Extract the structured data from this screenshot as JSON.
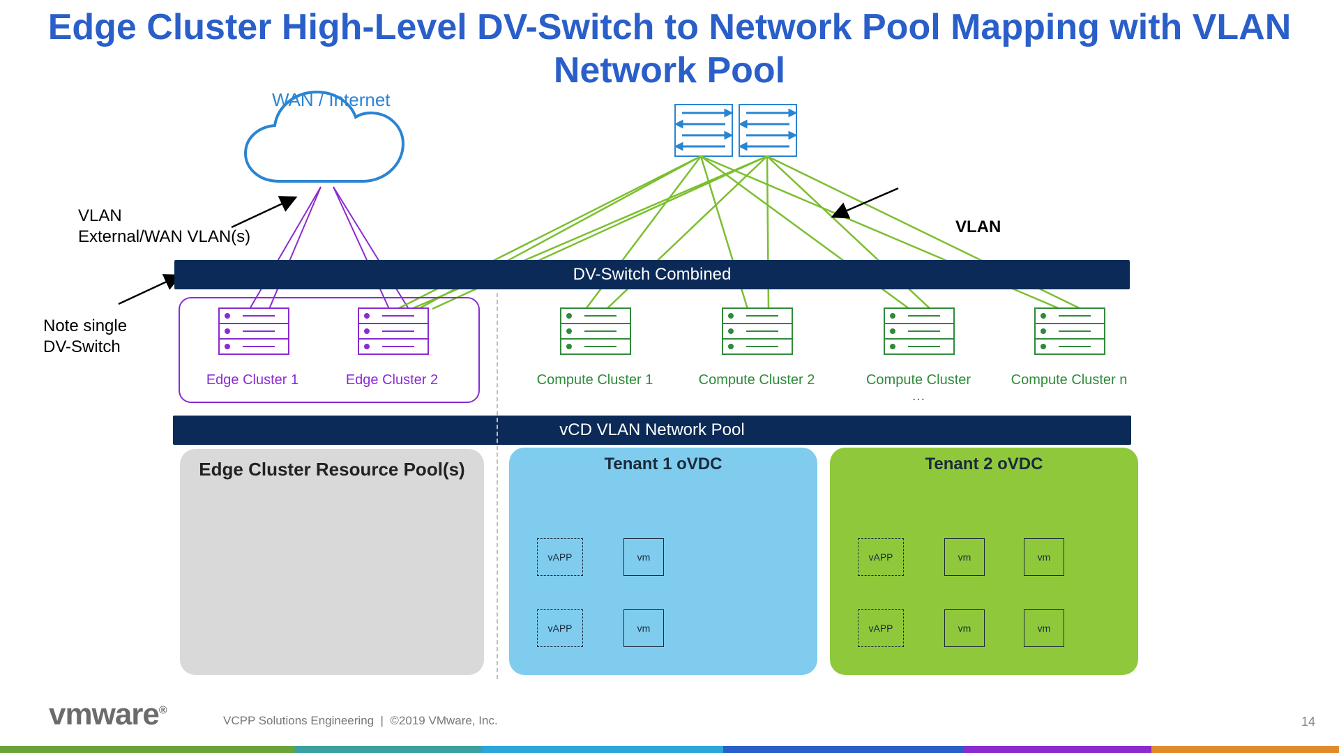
{
  "title": "Edge Cluster High-Level DV-Switch to Network Pool Mapping with VLAN Network Pool",
  "wan_label": "WAN / Internet",
  "annotations": {
    "ext_vlan_line1": "VLAN",
    "ext_vlan_line2": "External/WAN VLAN(s)",
    "note_single_line1": "Note single",
    "note_single_line2": "DV-Switch",
    "right_vlan": "VLAN"
  },
  "bars": {
    "dvswitch": "DV-Switch Combined",
    "pool": "vCD VLAN Network Pool"
  },
  "clusters": {
    "edge": [
      "Edge Cluster 1",
      "Edge Cluster 2"
    ],
    "compute": [
      "Compute Cluster 1",
      "Compute Cluster 2",
      "Compute Cluster …",
      "Compute Cluster n"
    ]
  },
  "panels": {
    "edge_pool_title": "Edge Cluster Resource Pool(s)",
    "tenant1_title": "Tenant 1 oVDC",
    "tenant2_title": "Tenant 2 oVDC",
    "vapp": "vAPP",
    "vm": "vm"
  },
  "footer": {
    "logo": "vmware",
    "reg": "®",
    "text": "VCPP Solutions Engineering  |  ©2019 VMware, Inc.",
    "page": "14"
  }
}
